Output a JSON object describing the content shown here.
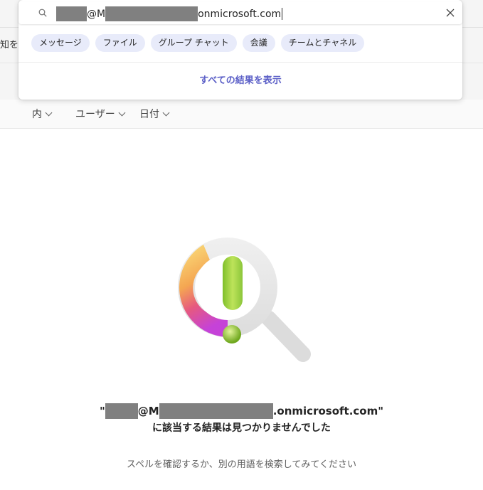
{
  "background": {
    "left_text": "知を"
  },
  "search": {
    "query_visible_1": "@M",
    "query_visible_2": "onmicrosoft.com",
    "search_icon": "search-icon",
    "clear_icon": "close-icon"
  },
  "chips": [
    "メッセージ",
    "ファイル",
    "グループ チャット",
    "会議",
    "チームとチャネル"
  ],
  "show_all_label": "すべての結果を表示",
  "filters": [
    {
      "label": "内"
    },
    {
      "label": "ユーザー"
    },
    {
      "label": "日付"
    }
  ],
  "empty_state": {
    "query_open_quote": "\"",
    "query_visible_1": "@M",
    "query_visible_2": ".onmicrosoft.com\"",
    "line2": "に該当する結果は見つかりませんでした",
    "hint": "スペルを確認するか、別の用語を検索してみてください"
  },
  "colors": {
    "accent": "#5b5fc7",
    "chip_bg": "#e8ebfa",
    "redaction": "#808080"
  }
}
